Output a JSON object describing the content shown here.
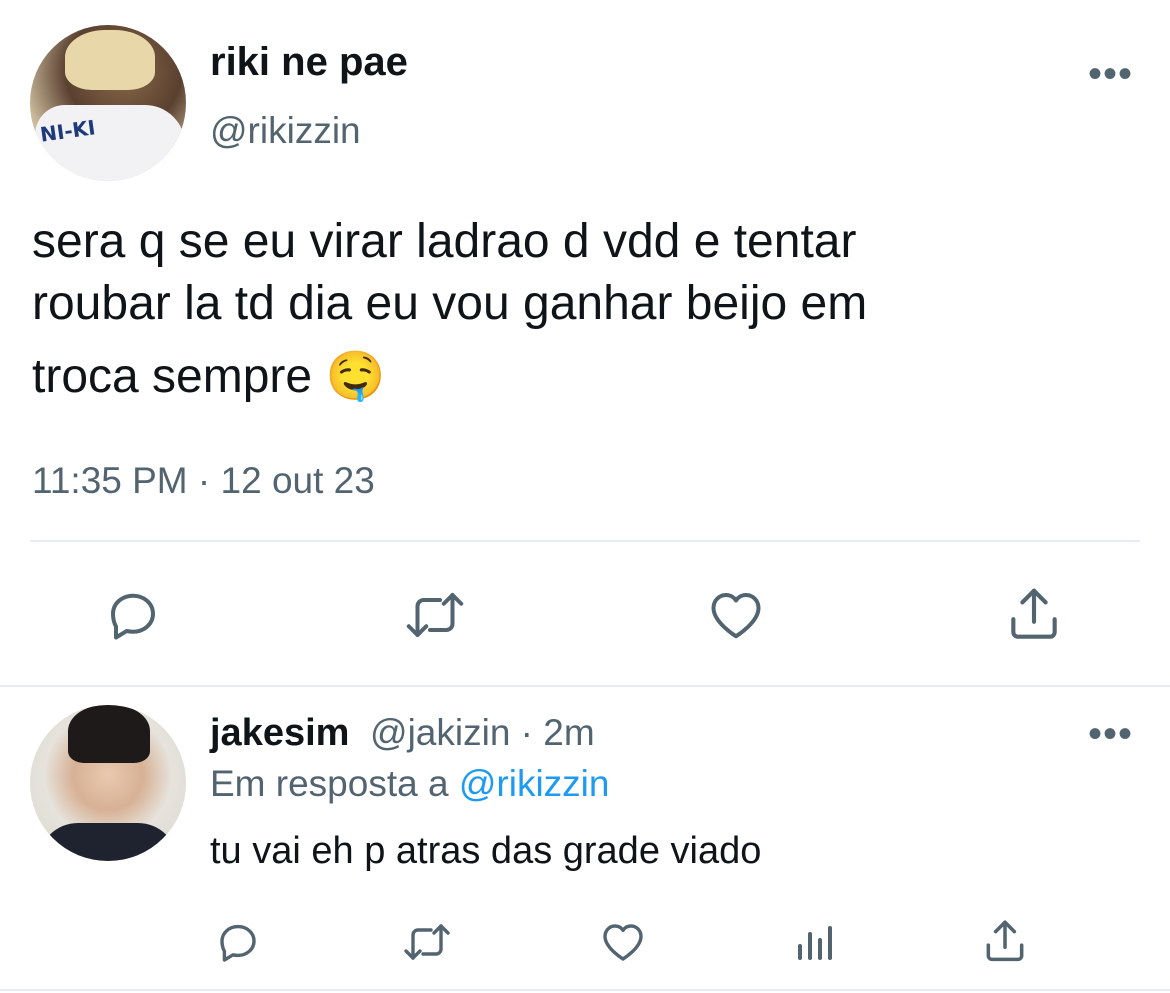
{
  "tweet": {
    "display_name": "riki ne pae",
    "handle": "@rikizzin",
    "text_line1": "sera q se eu virar ladrao d vdd e tentar",
    "text_line2": "roubar la td dia eu vou ganhar beijo em",
    "text_line3": "troca sempre 🤤",
    "timestamp": "11:35 PM · 12 out 23",
    "avatar_jersey_text": "NI-KI",
    "more_label": "•••",
    "actions": [
      "reply-icon",
      "retweet-icon",
      "like-icon",
      "share-icon"
    ]
  },
  "reply": {
    "display_name": "jakesim",
    "handle_time": "@jakizin · 2m",
    "reply_prefix": "Em resposta a",
    "reply_to": "@rikizzin",
    "text": "tu vai eh p atras das grade viado",
    "more_label": "•••",
    "actions": [
      "reply-icon",
      "retweet-icon",
      "like-icon",
      "analytics-icon",
      "share-icon"
    ]
  },
  "colors": {
    "text_primary": "#0f1419",
    "text_secondary": "#536471",
    "link": "#1d9bf0",
    "divider": "#e6ecf0"
  }
}
